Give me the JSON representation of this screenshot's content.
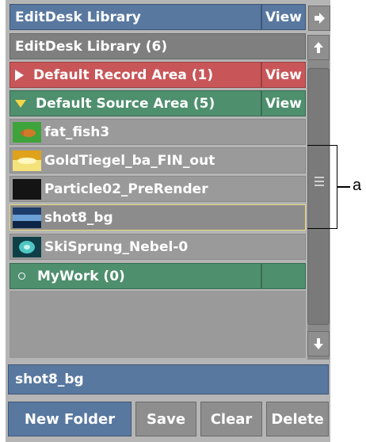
{
  "header": {
    "title": "EditDesk Library",
    "view_label": "View"
  },
  "library": {
    "label": "EditDesk Library (6)"
  },
  "record_area": {
    "label": "Default Record Area (1)",
    "view_label": "View"
  },
  "source_area": {
    "label": "Default Source Area (5)",
    "view_label": "View"
  },
  "clips": [
    {
      "name": "fat_fish3",
      "selected": false
    },
    {
      "name": "GoldTiegel_ba_FIN_out",
      "selected": false
    },
    {
      "name": "Particle02_PreRender",
      "selected": false
    },
    {
      "name": "shot8_bg",
      "selected": true
    },
    {
      "name": "SkiSprung_Nebel-0",
      "selected": false
    }
  ],
  "mywork": {
    "label": "MyWork (0)"
  },
  "name_field": {
    "value": "shot8_bg"
  },
  "buttons": {
    "new_folder": "New Folder",
    "save": "Save",
    "clear": "Clear",
    "delete": "Delete"
  },
  "callout": {
    "label": "a"
  },
  "colors": {
    "accent": "#5878a0",
    "record": "#c85658",
    "source": "#4e8f6d",
    "selection": "#e6da7a"
  }
}
